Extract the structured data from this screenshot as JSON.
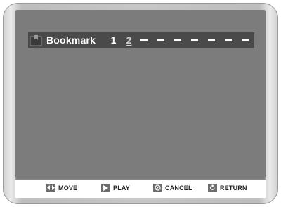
{
  "bookmark": {
    "title": "Bookmark",
    "slots": [
      "1",
      "2"
    ],
    "active_slot": "2",
    "empty_slots": 7
  },
  "footer": {
    "move": "MOVE",
    "play": "PLAY",
    "cancel": "CANCEL",
    "return": "RETURN"
  },
  "colors": {
    "screen": "#7c7c7c",
    "bar": "#4a4a4a",
    "text": "#ffffff"
  }
}
